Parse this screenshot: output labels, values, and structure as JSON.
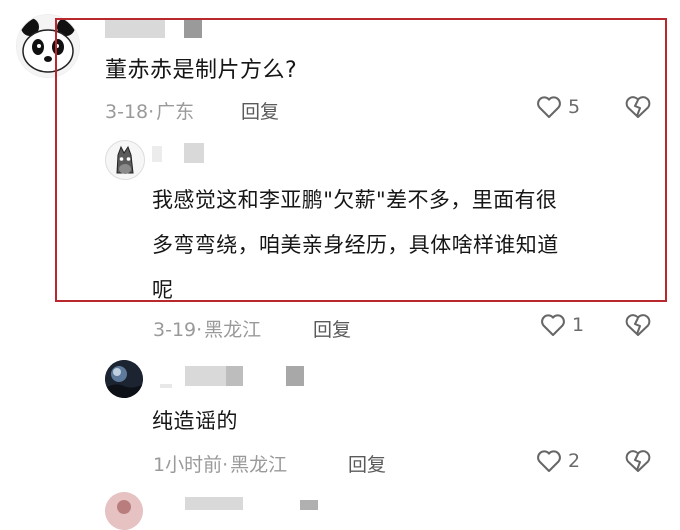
{
  "comments": [
    {
      "text": "董赤赤是制片方么?",
      "date": "3-18",
      "location": "广东",
      "reply_label": "回复",
      "likes": "5"
    },
    {
      "text_lines": [
        "我感觉这和李亚鹏\"欠薪\"差不多，里面有很",
        "多弯弯绕，咱美亲身经历，具体啥样谁知道",
        "呢"
      ],
      "date": "3-19",
      "location": "黑龙江",
      "reply_label": "回复",
      "likes": "1"
    },
    {
      "text": "纯造谣的",
      "date": "1小时前",
      "location": "黑龙江",
      "reply_label": "回复",
      "likes": "2"
    }
  ],
  "separator": "·",
  "colors": {
    "highlight_border": "#b8282e",
    "meta_text": "#9a9a9a"
  },
  "icons": [
    "heart-icon",
    "dislike-heart-icon",
    "panda-avatar",
    "horse-avatar",
    "night-avatar"
  ]
}
